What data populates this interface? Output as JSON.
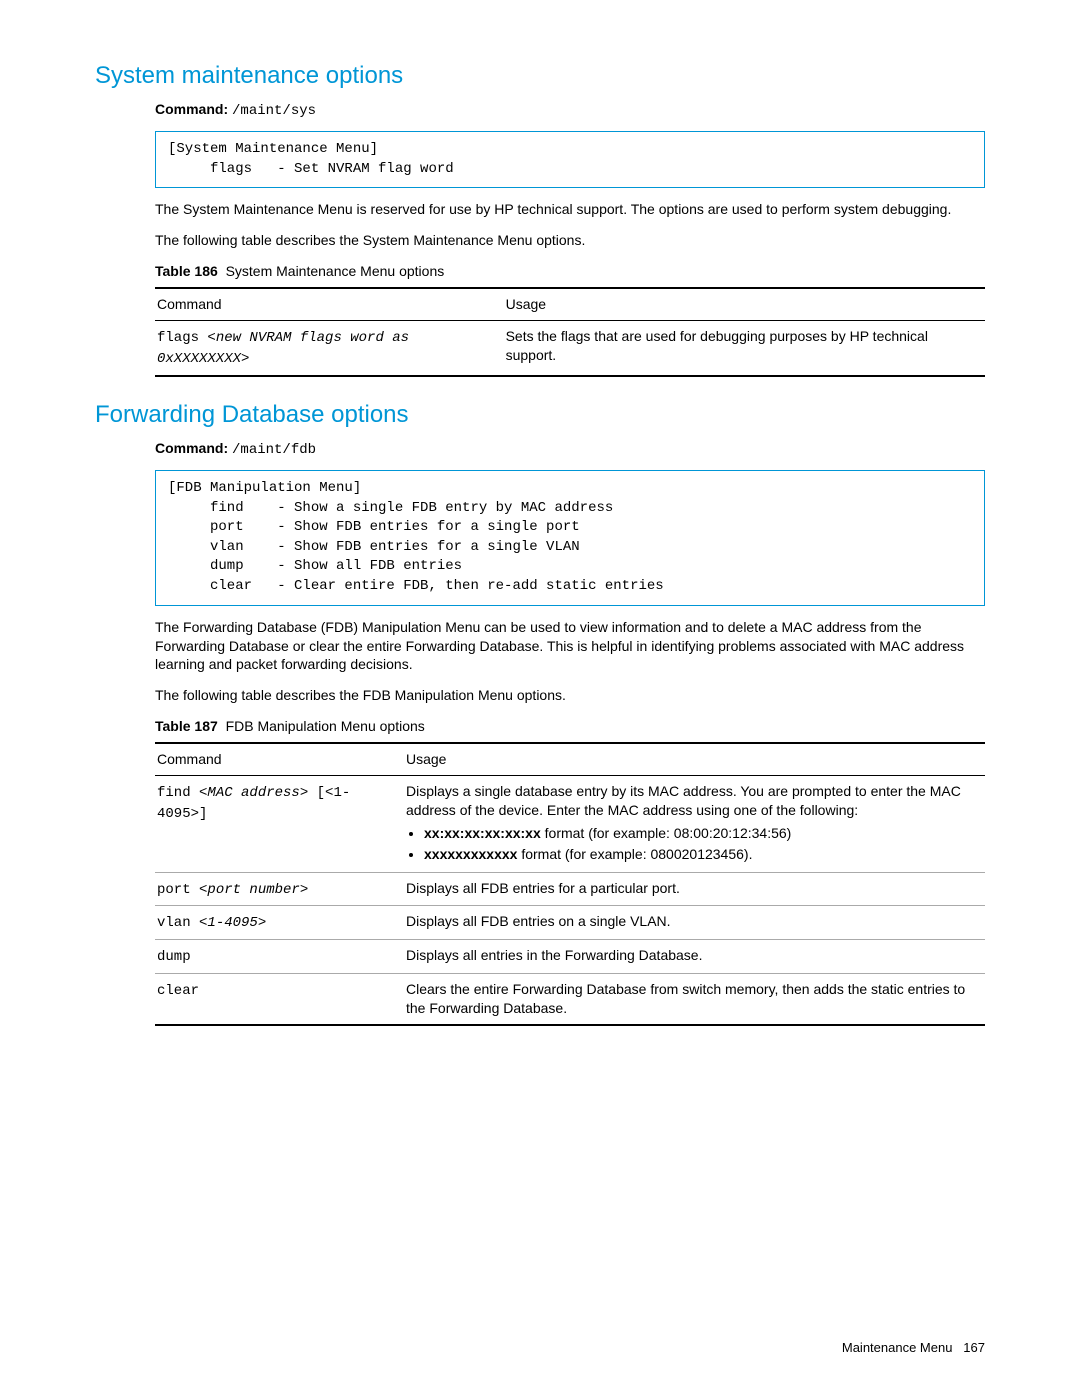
{
  "section1": {
    "title": "System maintenance options",
    "cmd_label": "Command:",
    "cmd_value": "/maint/sys",
    "menu_box": "[System Maintenance Menu]\n     flags   - Set NVRAM flag word",
    "para1": "The System Maintenance Menu is reserved for use by HP technical support. The options are used to perform system debugging.",
    "para2": "The following table describes the System Maintenance Menu options.",
    "table_caption_label": "Table 186",
    "table_caption_text": "System Maintenance Menu options",
    "th_cmd": "Command",
    "th_usage": "Usage",
    "rows": [
      {
        "cmd_prefix": "flags ",
        "cmd_italic": "<new NVRAM flags word as 0xXXXXXXXX>",
        "usage": "Sets the flags that are used for debugging purposes by HP technical support."
      }
    ]
  },
  "section2": {
    "title": "Forwarding Database options",
    "cmd_label": "Command:",
    "cmd_value": "/maint/fdb",
    "menu_box": "[FDB Manipulation Menu]\n     find    - Show a single FDB entry by MAC address\n     port    - Show FDB entries for a single port\n     vlan    - Show FDB entries for a single VLAN\n     dump    - Show all FDB entries\n     clear   - Clear entire FDB, then re-add static entries",
    "para1": "The Forwarding Database (FDB) Manipulation Menu can be used to view information and to delete a MAC address from the Forwarding Database or clear the entire Forwarding Database. This is helpful in identifying problems associated with MAC address learning and packet forwarding decisions.",
    "para2": "The following table describes the FDB Manipulation Menu options.",
    "table_caption_label": "Table 187",
    "table_caption_text": "FDB Manipulation Menu options",
    "th_cmd": "Command",
    "th_usage": "Usage",
    "rows": [
      {
        "cmd_prefix": "find ",
        "cmd_italic": "<MAC address>",
        "cmd_suffix": " [<1-4095>]",
        "usage_intro": "Displays a single database entry by its MAC address. You are prompted to enter the MAC address of the device. Enter the MAC address using one of the following:",
        "bullet1_bold": "xx:xx:xx:xx:xx:xx",
        "bullet1_rest": " format (for example: 08:00:20:12:34:56)",
        "bullet2_bold": "xxxxxxxxxxxx",
        "bullet2_rest": " format (for example: 080020123456)."
      },
      {
        "cmd_prefix": "port ",
        "cmd_italic": "<port number>",
        "usage": "Displays all FDB entries for a particular port."
      },
      {
        "cmd_prefix": "vlan ",
        "cmd_italic": "<1-4095>",
        "usage": "Displays all FDB entries on a single VLAN."
      },
      {
        "cmd_prefix": "dump",
        "usage": "Displays all entries in the Forwarding Database."
      },
      {
        "cmd_prefix": "clear",
        "usage": "Clears the entire Forwarding Database from switch memory, then adds the static entries to the Forwarding Database."
      }
    ]
  },
  "footer": {
    "section": "Maintenance Menu",
    "page": "167"
  }
}
